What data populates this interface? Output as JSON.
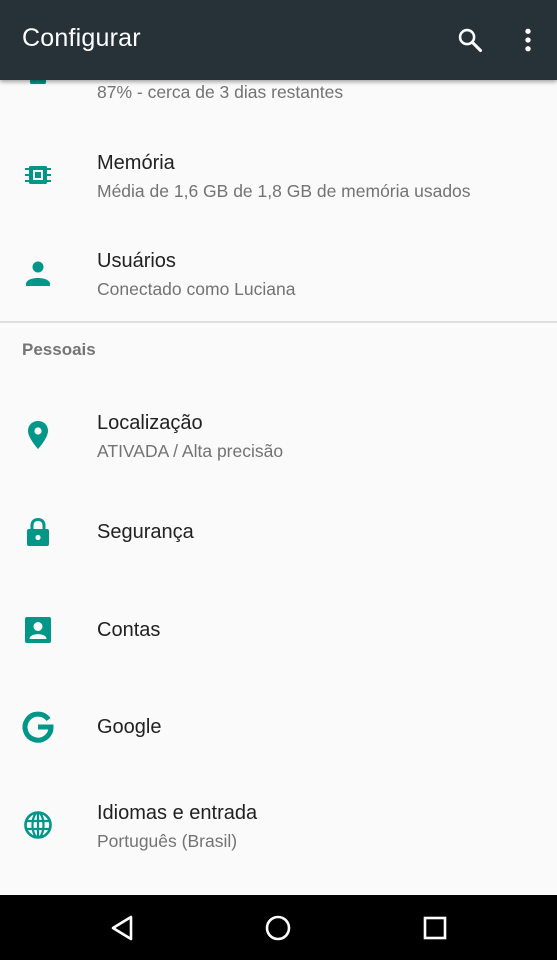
{
  "appbar": {
    "title": "Configurar",
    "icons": [
      "search-icon",
      "more-vert-icon"
    ]
  },
  "colors": {
    "appbar": "#263238",
    "accent": "#009688",
    "navbar": "#000000"
  },
  "items_top": [
    {
      "summary": "87% - cerca de 3 dias restantes",
      "icon": "battery-icon"
    },
    {
      "label": "Memória",
      "summary": "Média de 1,6 GB de 1,8 GB de memória usados",
      "icon": "memory-chip-icon"
    },
    {
      "label": "Usuários",
      "summary": "Conectado como Luciana",
      "icon": "person-icon"
    }
  ],
  "category": "Pessoais",
  "items_personal": [
    {
      "label": "Localização",
      "summary": "ATIVADA / Alta precisão",
      "icon": "location-pin-icon"
    },
    {
      "label": "Segurança",
      "icon": "lock-icon"
    },
    {
      "label": "Contas",
      "icon": "account-box-icon"
    },
    {
      "label": "Google",
      "icon": "google-icon"
    },
    {
      "label": "Idiomas e entrada",
      "summary": "Português (Brasil)",
      "icon": "globe-icon"
    }
  ],
  "navbar": [
    "back-icon",
    "home-icon",
    "recents-icon"
  ]
}
